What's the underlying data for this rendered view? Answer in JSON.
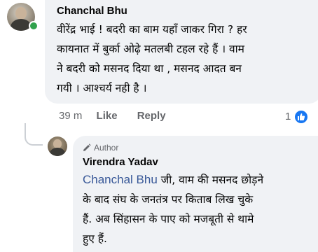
{
  "comment": {
    "author": "Chanchal Bhu",
    "text_lines": [
      "वीरेंद्र भाई ! बदरी का बाम  यहाँ जाकर  गिरा ? हर",
      "कायनात में बुर्का ओढ़े मतलबी टहल रहे हैं । वाम",
      "ने बदरी को मसनद दिया था , मसनद  आदत बन",
      "गयी । आश्चर्य नही है ।"
    ],
    "time": "39 m",
    "like_label": "Like",
    "reply_label": "Reply",
    "reaction_count": "1",
    "reaction_icon": "thumbs-up-icon",
    "online_status_color": "#31a24c"
  },
  "reply": {
    "badge_label": "Author",
    "badge_icon": "pencil-icon",
    "author": "Virendra Yadav",
    "mention": "Chanchal Bhu",
    "text_first_line_rest": " जी, वाम की मसनद छोड़ने",
    "text_lines": [
      "के बाद संघ के जनतंत्र पर किताब लिख चुके",
      "हैं. अब सिंहासन के पाए को मजबूती से थामे",
      "हुए हैं."
    ]
  },
  "colors": {
    "bubble_bg": "#f0f2f5",
    "mention": "#385898",
    "secondary_text": "#65676b",
    "like_blue": "#1877f2"
  }
}
